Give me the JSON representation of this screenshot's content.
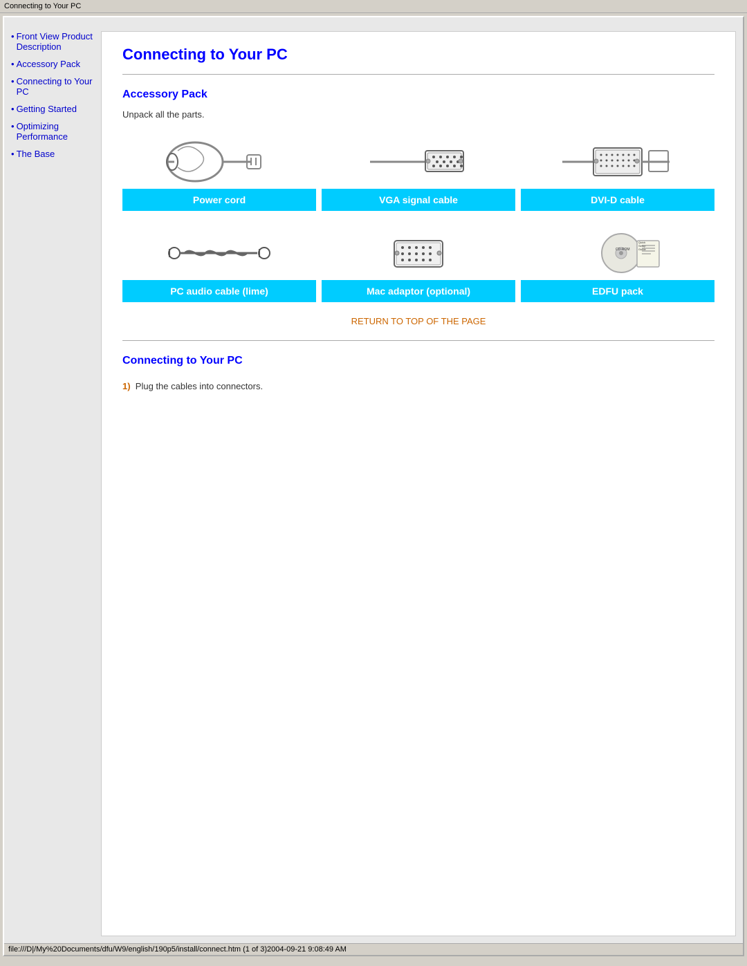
{
  "title_bar": {
    "text": "Connecting to Your PC"
  },
  "sidebar": {
    "items": [
      {
        "label": "Front View Product Description",
        "href": "#front-view"
      },
      {
        "label": "Accessory Pack",
        "href": "#accessory"
      },
      {
        "label": "Connecting to Your PC",
        "href": "#connecting"
      },
      {
        "label": "Getting Started",
        "href": "#getting-started"
      },
      {
        "label": "Optimizing Performance",
        "href": "#performance"
      },
      {
        "label": "The Base",
        "href": "#base"
      }
    ]
  },
  "main": {
    "page_title": "Connecting to Your PC",
    "accessory_section": {
      "title": "Accessory Pack",
      "unpack_text": "Unpack all the parts.",
      "cables": [
        {
          "label": "Power cord"
        },
        {
          "label": "VGA signal cable"
        },
        {
          "label": "DVI-D cable"
        },
        {
          "label": "PC audio cable (lime)"
        },
        {
          "label": "Mac adaptor (optional)"
        },
        {
          "label": "EDFU pack"
        }
      ]
    },
    "return_link": "RETURN TO TOP OF THE PAGE",
    "connecting_section": {
      "title": "Connecting to Your PC",
      "step1_number": "1)",
      "step1_text": "Plug the cables into connectors."
    }
  },
  "status_bar": {
    "text": "file:///D|/My%20Documents/dfu/W9/english/190p5/install/connect.htm (1 of 3)2004-09-21 9:08:49 AM"
  }
}
